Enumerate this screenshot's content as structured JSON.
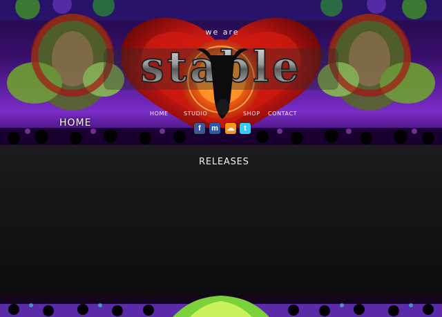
{
  "header": {
    "tagline": "we are",
    "logo_text": "stable",
    "nav": [
      {
        "label": "HOME"
      },
      {
        "label": "STUDIO"
      },
      {
        "label": "SHOP"
      },
      {
        "label": "CONTACT"
      }
    ],
    "social": [
      {
        "icon": "facebook-icon",
        "glyph": "f",
        "color": "#3b5998"
      },
      {
        "icon": "myspace-icon",
        "glyph": "m",
        "color": "#2b5aa8"
      },
      {
        "icon": "soundcloud-icon",
        "glyph": "☁",
        "color": "#f7941d"
      },
      {
        "icon": "twitter-icon",
        "glyph": "t",
        "color": "#33ccff"
      }
    ]
  },
  "page": {
    "heading": "HOME",
    "section_title": "RELEASES"
  },
  "colors": {
    "background": "#000000",
    "content_panel": "#161618",
    "heart_red": "#b3130f",
    "fractal_purple": "#7a2cc8",
    "fractal_green": "#7bd13a"
  }
}
